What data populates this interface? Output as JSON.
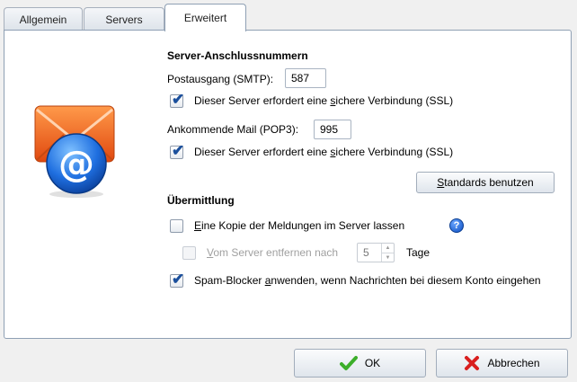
{
  "tabs": [
    {
      "label": "Allgemein"
    },
    {
      "label": "Servers"
    },
    {
      "label": "Erweitert",
      "active": true
    }
  ],
  "ports": {
    "heading": "Server-Anschlussnummern",
    "smtp_label": "Postausgang (SMTP):",
    "smtp_value": "587",
    "smtp_ssl_pre": "Dieser Server erfordert eine ",
    "smtp_ssl_u": "s",
    "smtp_ssl_post": "ichere Verbindung (SSL)",
    "smtp_ssl_checked": true,
    "pop3_label": "Ankommende Mail (POP3):",
    "pop3_value": "995",
    "pop3_ssl_pre": "Dieser Server erfordert eine ",
    "pop3_ssl_u": "s",
    "pop3_ssl_post": "ichere Verbindung (SSL)",
    "pop3_ssl_checked": true,
    "defaults_u": "S",
    "defaults_rest": "tandards benutzen"
  },
  "delivery": {
    "heading": "Übermittlung",
    "copy_u": "E",
    "copy_rest": "ine Kopie der Meldungen im Server lassen",
    "copy_checked": false,
    "help_glyph": "?",
    "remove_u": "V",
    "remove_rest": "om Server entfernen nach",
    "remove_checked": false,
    "days_value": "5",
    "days_label": "Tage",
    "spam_pre": "Spam-Blocker ",
    "spam_u": "a",
    "spam_post": "nwenden, wenn Nachrichten bei diesem Konto eingehen",
    "spam_checked": true
  },
  "buttons": {
    "ok_label": "OK",
    "cancel_label": "Abbrechen"
  },
  "icons": {
    "account": "email-account-icon",
    "check": "checkmark-icon",
    "cancel": "cross-icon",
    "help": "help-icon"
  },
  "colors": {
    "envelope": "#f0641e",
    "at_circle": "#1f6fe0",
    "ok_green": "#3cae2a",
    "cancel_red": "#d91f1f"
  }
}
